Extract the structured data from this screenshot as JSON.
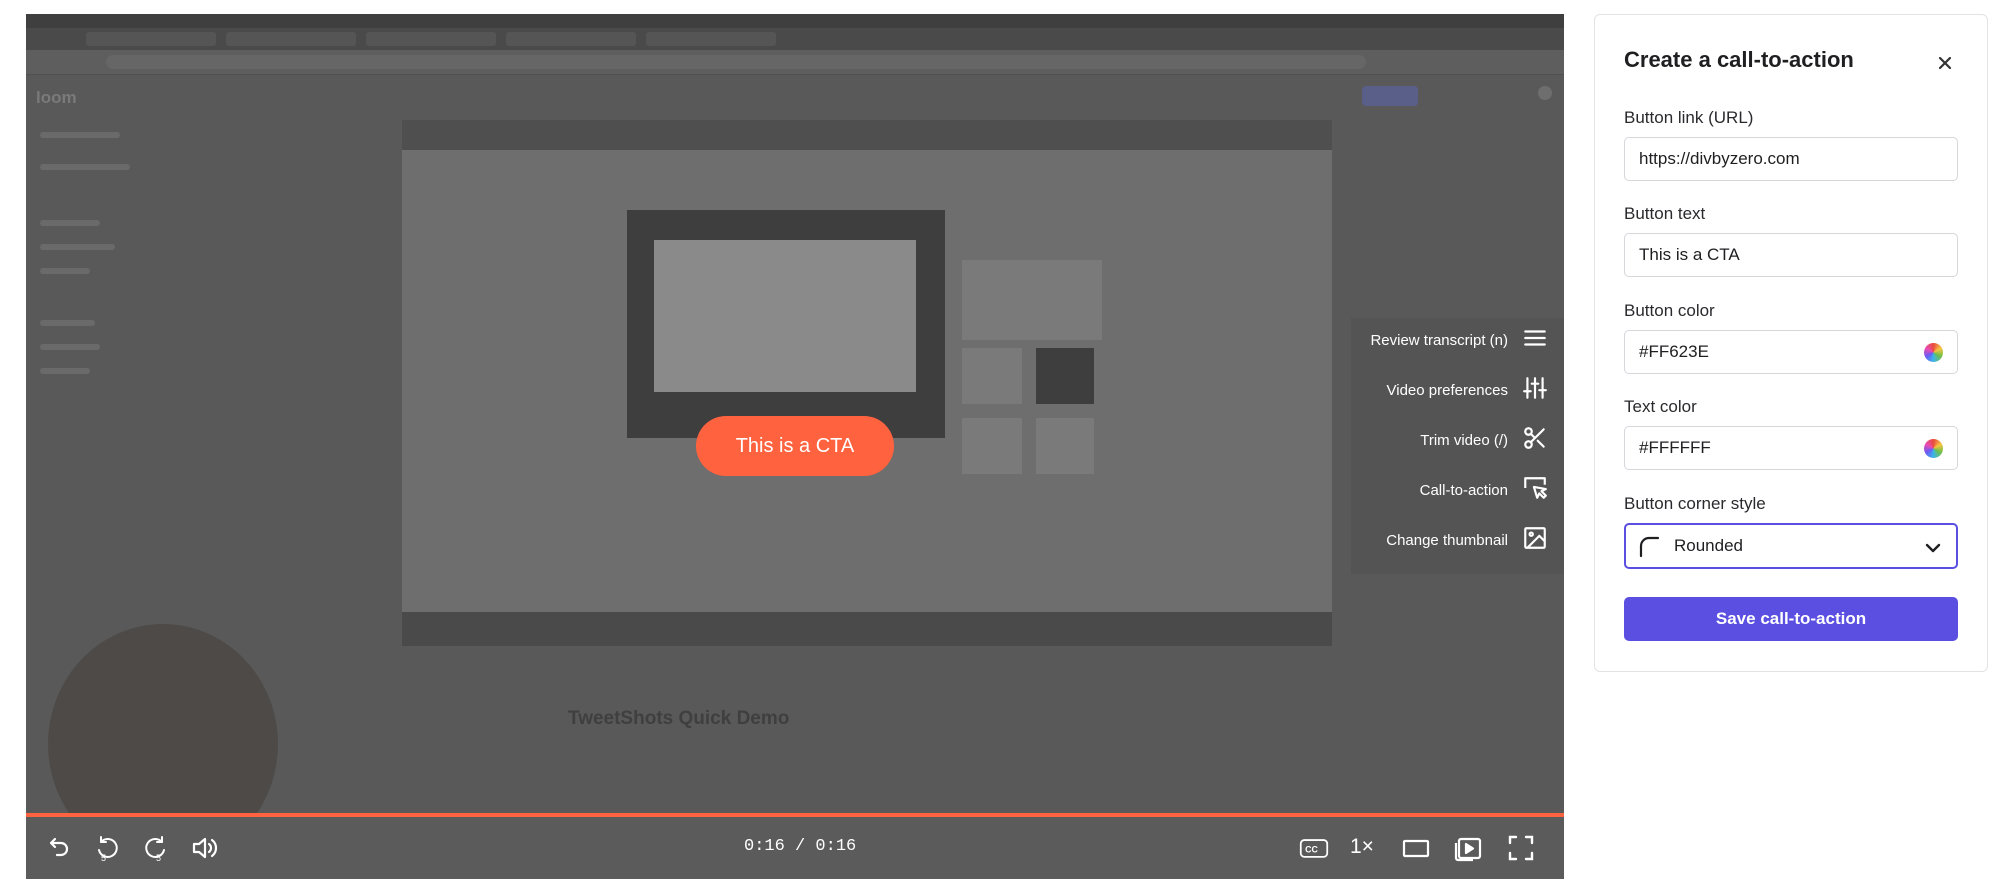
{
  "video": {
    "cta_text": "This is a CTA",
    "cta_color": "#FF623E",
    "time_display": "0:16 / 0:16",
    "progress": 1.0,
    "background_title": "TweetShots Quick Demo",
    "background_logo": "loom"
  },
  "edit_menu": {
    "items": [
      {
        "label": "Review transcript (n)",
        "icon": "lines-icon"
      },
      {
        "label": "Video preferences",
        "icon": "sliders-icon"
      },
      {
        "label": "Trim video (/)",
        "icon": "scissors-icon"
      },
      {
        "label": "Call-to-action",
        "icon": "cursor-click-icon"
      },
      {
        "label": "Change thumbnail",
        "icon": "image-icon"
      }
    ]
  },
  "controls": {
    "speed_label": "1×",
    "skip_back_seconds": "5",
    "skip_forward_seconds": "5",
    "cc_label": "CC"
  },
  "panel": {
    "title": "Create a call-to-action",
    "link_label": "Button link (URL)",
    "link_value": "https://divbyzero.com",
    "text_label": "Button text",
    "text_value": "This is a CTA",
    "button_color_label": "Button color",
    "button_color_value": "#FF623E",
    "text_color_label": "Text color",
    "text_color_value": "#FFFFFF",
    "corner_label": "Button corner style",
    "corner_value": "Rounded",
    "save_label": "Save call-to-action",
    "accent_color": "#5A4FE0"
  }
}
